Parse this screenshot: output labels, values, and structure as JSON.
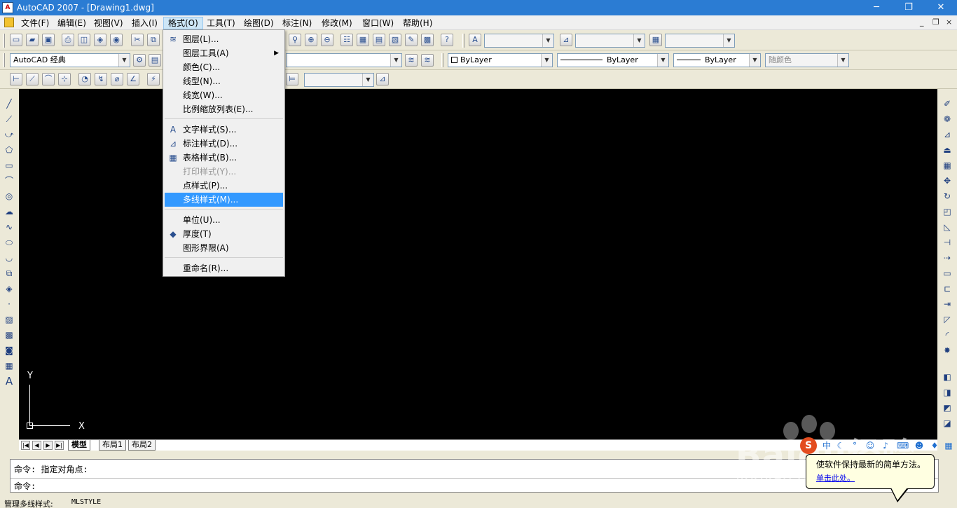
{
  "window": {
    "title": "AutoCAD 2007 - [Drawing1.dwg]",
    "app_icon_text": "A",
    "minimize": "─",
    "maximize": "❐",
    "close": "✕"
  },
  "menubar": {
    "items": [
      "文件(F)",
      "编辑(E)",
      "视图(V)",
      "插入(I)",
      "格式(O)",
      "工具(T)",
      "绘图(D)",
      "标注(N)",
      "修改(M)",
      "窗口(W)",
      "帮助(H)"
    ],
    "active_index": 4,
    "mdi_controls": [
      "_",
      "❐",
      "×"
    ]
  },
  "toolbars": {
    "workspace": "AutoCAD 经典",
    "color": "ByLayer",
    "linetype": "ByLayer",
    "lineweight": "ByLayer",
    "plotstyle": "随颜色",
    "text_style": "",
    "dim_style": "",
    "table_style": ""
  },
  "format_menu": {
    "items": [
      {
        "label": "图层(L)...",
        "icon": "layers-icon",
        "glyph": "≋"
      },
      {
        "label": "图层工具(A)",
        "submenu": true
      },
      {
        "label": "颜色(C)..."
      },
      {
        "label": "线型(N)..."
      },
      {
        "label": "线宽(W)..."
      },
      {
        "label": "比例缩放列表(E)..."
      },
      {
        "separator": true
      },
      {
        "label": "文字样式(S)...",
        "icon": "text-style-icon",
        "glyph": "A"
      },
      {
        "label": "标注样式(D)...",
        "icon": "dim-style-icon",
        "glyph": "⊿"
      },
      {
        "label": "表格样式(B)...",
        "icon": "table-style-icon",
        "glyph": "▦"
      },
      {
        "label": "打印样式(Y)...",
        "disabled": true
      },
      {
        "label": "点样式(P)..."
      },
      {
        "label": "多线样式(M)...",
        "highlighted": true
      },
      {
        "separator": true
      },
      {
        "label": "单位(U)..."
      },
      {
        "label": "厚度(T)",
        "icon": "thickness-icon",
        "glyph": "◆"
      },
      {
        "label": "图形界限(A)"
      },
      {
        "separator": true
      },
      {
        "label": "重命名(R)..."
      }
    ]
  },
  "ucs": {
    "x_label": "X",
    "y_label": "Y"
  },
  "layout_tabs": {
    "nav": [
      "|◀",
      "◀",
      "▶",
      "▶|"
    ],
    "tabs": [
      "模型",
      "布局1",
      "布局2"
    ],
    "active_index": 0
  },
  "command": {
    "history": "命令: 指定对角点:",
    "prompt": "命令:"
  },
  "status": {
    "left": "管理多线样式:",
    "cmd": "MLSTYLE"
  },
  "ime": {
    "logo": "S",
    "mode": "中"
  },
  "balloon": {
    "message": "使软件保持最新的简单方法。",
    "link": "单击此处。"
  },
  "watermark": {
    "brand": "Baidu经验",
    "url": "jingyan.baidu.com"
  }
}
